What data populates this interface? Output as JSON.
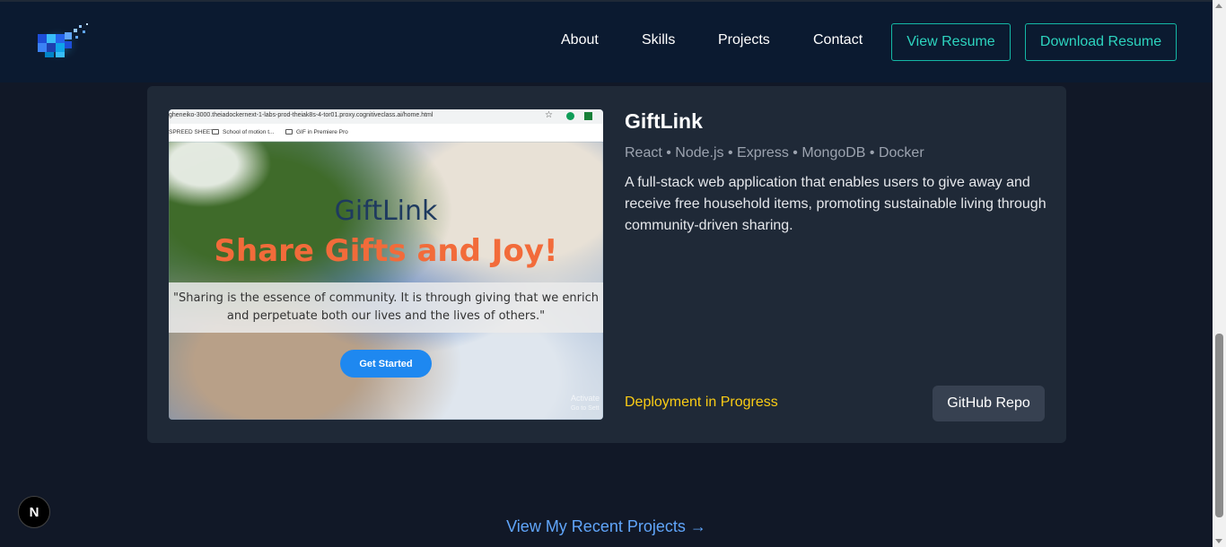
{
  "nav": {
    "links": [
      "About",
      "Skills",
      "Projects",
      "Contact"
    ],
    "view_resume": "View Resume",
    "download_resume": "Download Resume"
  },
  "project": {
    "title": "GiftLink",
    "stack": "React • Node.js • Express • MongoDB • Docker",
    "description": "A full-stack web application that enables users to give away and receive free household items, promoting sustainable living through community-driven sharing.",
    "status": "Deployment in Progress",
    "repo_button": "GitHub Repo",
    "screenshot": {
      "url": "gheneiko-3000.theiadockernext-1-labs-prod-theiak8s-4-tor01.proxy.cognitiveclass.ai/home.html",
      "bookmarks": [
        "SPREED SHEET",
        "School of motion t...",
        "GIF in Premiere Pro"
      ],
      "app_title": "GiftLink",
      "tagline": "Share Gifts and Joy!",
      "quote": "\"Sharing is the essence of community. It is through giving that we enrich and perpetuate both our lives and the lives of others.\"",
      "cta": "Get Started",
      "watermark_line1": "Activate",
      "watermark_line2": "Go to Sett"
    }
  },
  "recent_link": "View My Recent Projects →",
  "next_badge": "N",
  "colors": {
    "background": "#111827",
    "navbar": "#0b1a30",
    "card": "#1f2937",
    "accent_teal": "#2dd4bf",
    "status_yellow": "#facc15",
    "link_blue": "#60a5fa"
  }
}
